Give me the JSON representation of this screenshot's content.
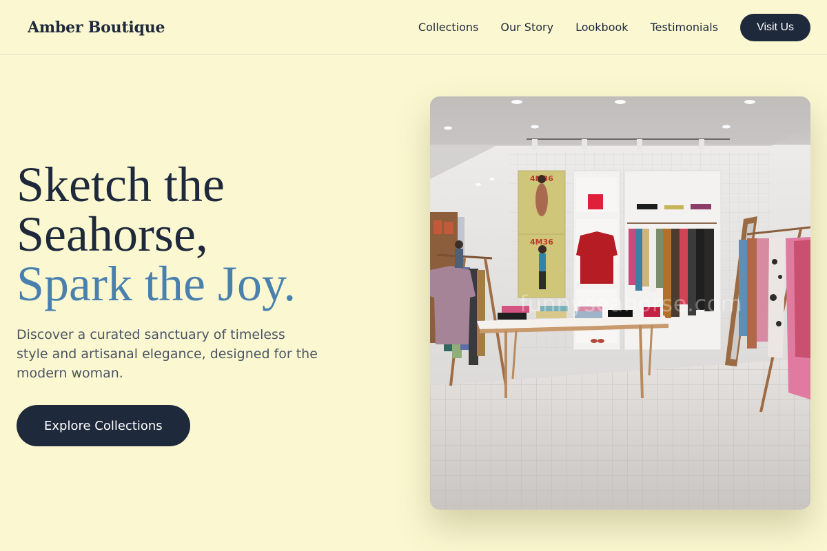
{
  "nav": {
    "brand": "Amber Boutique",
    "links": [
      "Collections",
      "Our Story",
      "Lookbook",
      "Testimonials"
    ],
    "visit_label": "Visit Us"
  },
  "hero": {
    "headline_line1": "Sketch the",
    "headline_line2": "Seahorse,",
    "headline_accent": "Spark the Joy.",
    "subtext": "Discover a curated sanctuary of timeless style and artisanal elegance, designed for the modern woman.",
    "cta_label": "Explore Collections"
  },
  "image": {
    "watermark": "funnyseahorse.com",
    "poster_text": "4M36"
  },
  "colors": {
    "background": "#fbf8d1",
    "dark": "#1e293b",
    "accent": "#4a80ae"
  }
}
